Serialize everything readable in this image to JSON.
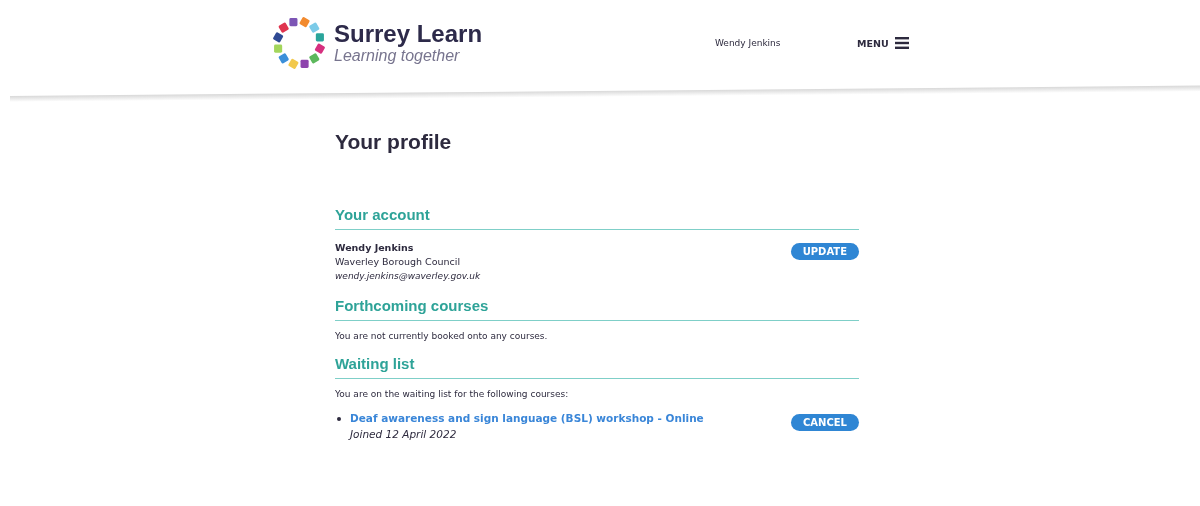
{
  "header": {
    "brand": "Surrey Learn",
    "tagline": "Learning together",
    "user_name": "Wendy Jenkins",
    "menu_label": "MENU"
  },
  "title": "Your profile",
  "account": {
    "heading": "Your account",
    "name": "Wendy Jenkins",
    "organisation": "Waverley Borough Council",
    "email": "wendy.jenkins@waverley.gov.uk",
    "button": "UPDATE"
  },
  "forthcoming": {
    "heading": "Forthcoming courses",
    "message": "You are not currently booked onto any courses."
  },
  "waiting_list": {
    "heading": "Waiting list",
    "intro": "You are on the waiting list for the following courses:",
    "items": [
      {
        "course": "Deaf awareness and sign language (BSL) workshop - Online",
        "joined": "Joined 12 April 2022",
        "button": "CANCEL"
      }
    ]
  }
}
